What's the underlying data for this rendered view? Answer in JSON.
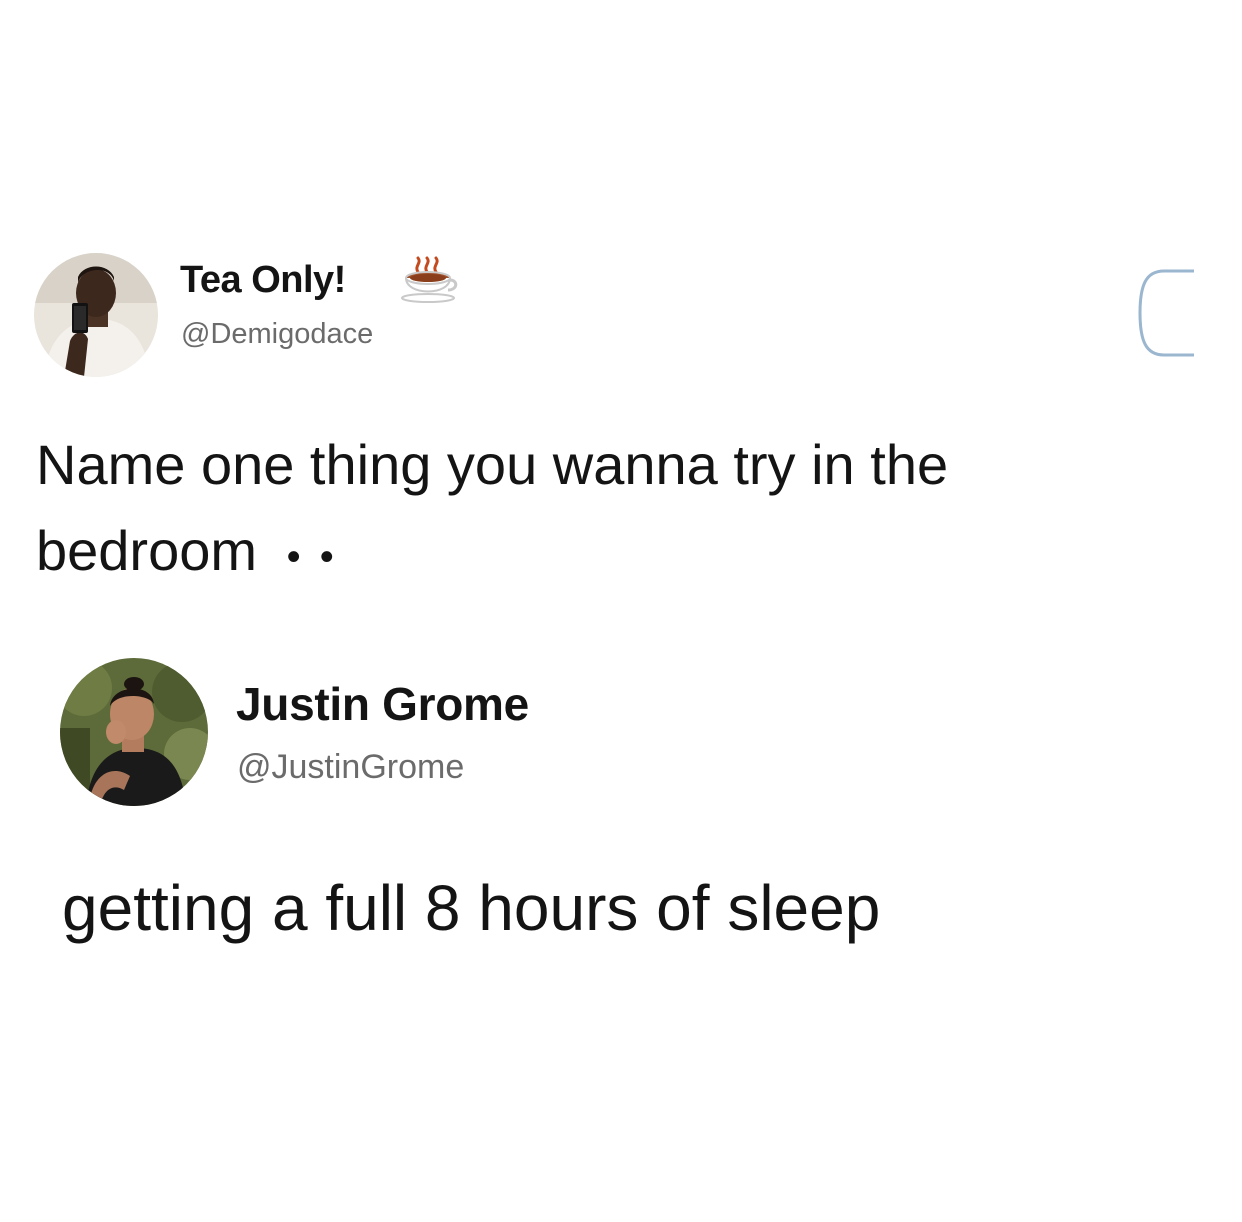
{
  "original_tweet": {
    "display_name": "Tea Only!",
    "name_emoji": "tea-icon",
    "handle": "@Demigodace",
    "text_line1": "Name one thing you wanna try in the",
    "text_line2": "bedroom",
    "trailing_mark": "• •",
    "corner_mark": "C"
  },
  "reply_tweet": {
    "display_name": "Justin Grome",
    "handle": "@JustinGrome",
    "text": "getting a full 8 hours of sleep"
  },
  "colors": {
    "background": "#ffffff",
    "text": "#141414",
    "handle": "#6b6b6b",
    "corner_mark": "#9bb6cf"
  }
}
